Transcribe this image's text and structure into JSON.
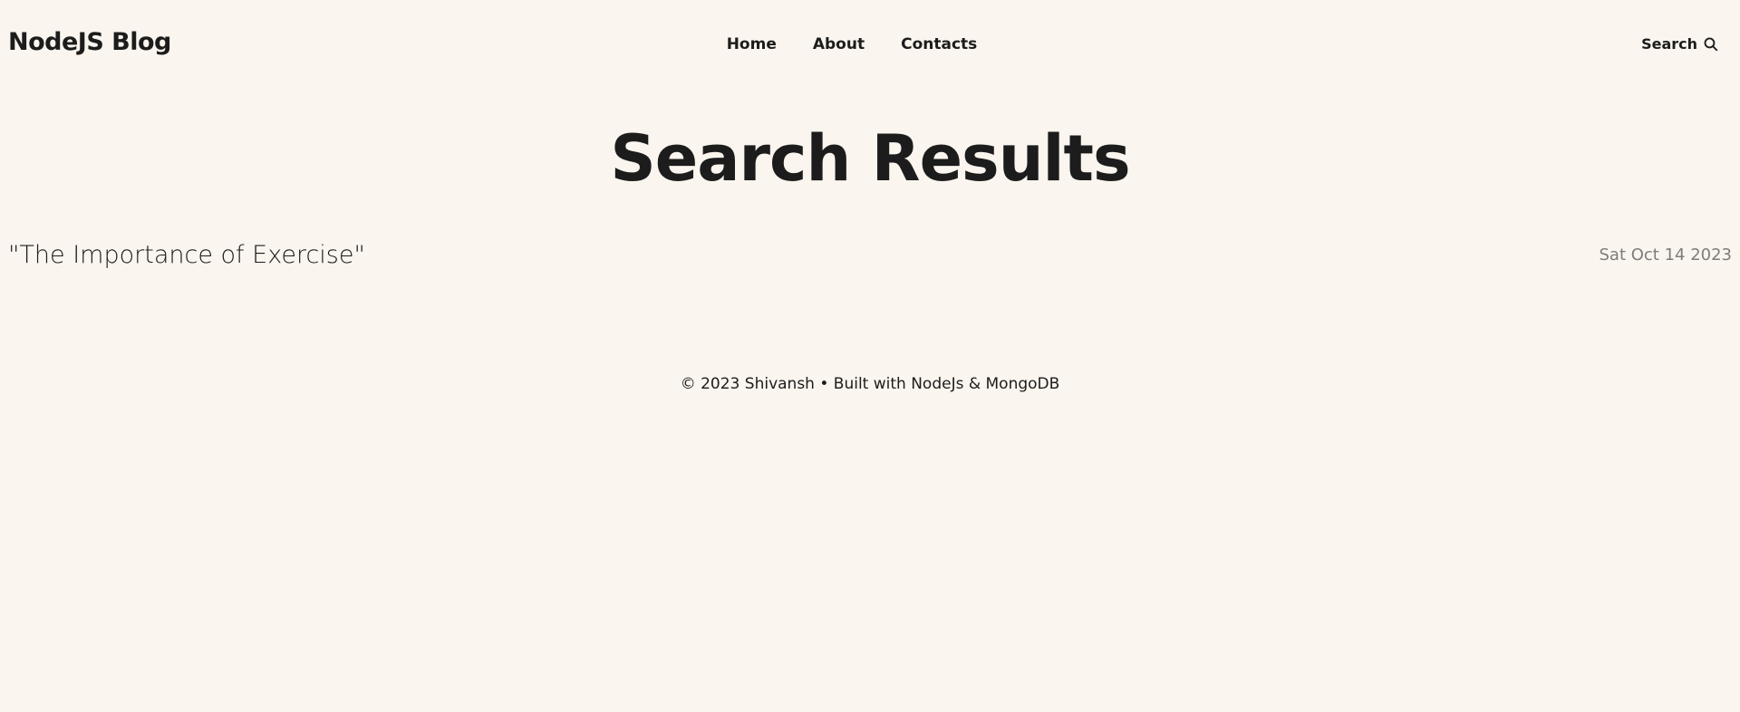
{
  "header": {
    "logo": "NodeJS Blog",
    "nav": [
      {
        "label": "Home"
      },
      {
        "label": "About"
      },
      {
        "label": "Contacts"
      }
    ],
    "search_label": "Search",
    "search_icon": "search-icon"
  },
  "main": {
    "title": "Search Results",
    "results": [
      {
        "title": "\"The Importance of Exercise\"",
        "date": "Sat Oct 14 2023"
      }
    ]
  },
  "footer": {
    "text": "© 2023 Shivansh • Built with NodeJs & MongoDB"
  },
  "colors": {
    "background": "#faf5ee",
    "text": "#1c1c1c",
    "muted": "#7c7c7c"
  }
}
